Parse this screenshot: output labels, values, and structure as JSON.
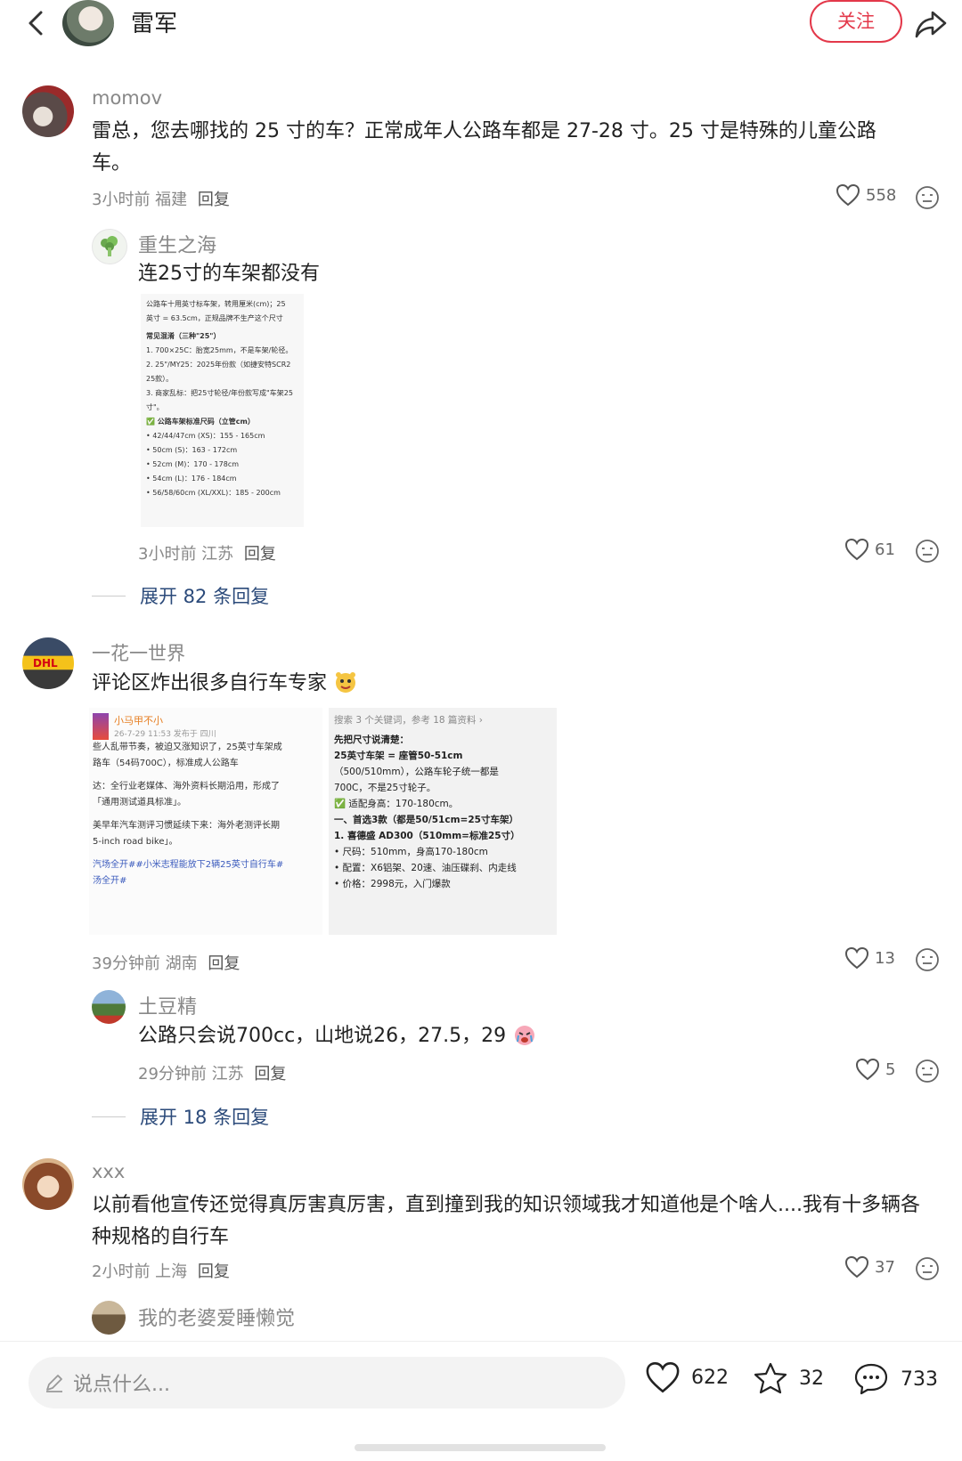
{
  "header": {
    "name": "雷军",
    "follow_label": "关注"
  },
  "comments": [
    {
      "user": "momov",
      "text": "雷总，您去哪找的 25 寸的车？正常成年人公路车都是 27-28 寸。25 寸是特殊的儿童公路车。",
      "meta": "3小时前 福建",
      "reply_label": "回复",
      "likes": "558",
      "replies": [
        {
          "user": "重生之海",
          "text": "连25寸的车架都没有",
          "meta": "3小时前 江苏",
          "reply_label": "回复",
          "likes": "61",
          "image_lines": [
            "公路车十用英寸标车架，转用厘米(cm)；25",
            "英寸 = 63.5cm，正规品牌不生产这个尺寸",
            "常见混淆（三种\"25\"）",
            "1. 700×25C：胎宽25mm，不是车架/轮径。",
            "2. 25\"/MY25：2025年份款（如捷安特SCR2 25款）。",
            "3. 商家乱标：把25寸轮径/年份款写成\"车架25寸\"。",
            "✅ 公路车架标准尺码（立管cm）",
            "• 42/44/47cm (XS)：155 - 165cm",
            "• 50cm (S)：163 - 172cm",
            "• 52cm (M)：170 - 178cm",
            "• 54cm (L)：176 - 184cm",
            "• 56/58/60cm (XL/XXL)：185 - 200cm"
          ]
        }
      ],
      "expand_label": "展开 82 条回复"
    },
    {
      "user": "一花一世界",
      "text": "评论区炸出很多自行车专家",
      "meta": "39分钟前 湖南",
      "reply_label": "回复",
      "likes": "13",
      "image_left": {
        "account": "小马甲不小",
        "date": "26-7-29 11:53  发布于 四川",
        "lines": [
          "些人乱带节奏，被迫又涨知识了，25英寸车架成",
          "路车（54码700C），标准成人公路车",
          "",
          "达：全行业老媒体、海外资料长期沿用，形成了",
          "「通用测试道具标准」。",
          "",
          "美早年汽车测评习惯延续下来：海外老测评长期",
          "5-inch road bike」。",
          "",
          "汽场全开##小米志程能放下2辆25英寸自行车#",
          "汤全开#"
        ]
      },
      "image_right": {
        "search": "搜索 3 个关键词，参考 18 篇资料 ›",
        "lines": [
          "先把尺寸说清楚：",
          "25英寸车架 = 座管50-51cm",
          "（500/510mm），公路车轮子统一都是",
          "700C，不是25寸轮子。",
          "✅ 适配身高：170-180cm。",
          "一、首选3款（都是50/51cm=25寸车架）",
          "1. 喜德盛 AD300（510mm=标准25寸）",
          "• 尺码：510mm，身高170-180cm",
          "• 配置：X6铝架、20速、油压碟刹、内走线",
          "• 价格：2998元，入门爆款"
        ]
      },
      "replies": [
        {
          "user": "土豆精",
          "text": "公路只会说700cc，山地说26，27.5，29",
          "meta": "29分钟前 江苏",
          "reply_label": "回复",
          "likes": "5"
        }
      ],
      "expand_label": "展开 18 条回复"
    },
    {
      "user": "xxx",
      "text": "以前看他宣传还觉得真厉害真厉害，直到撞到我的知识领域我才知道他是个啥人....我有十多辆各种规格的自行车",
      "meta": "2小时前 上海",
      "reply_label": "回复",
      "likes": "37",
      "replies": [
        {
          "user": "我的老婆爱睡懒觉"
        }
      ]
    }
  ],
  "bottom": {
    "input_placeholder": "说点什么...",
    "likes": "622",
    "favorites": "32",
    "comments": "733"
  },
  "icons": [
    "back-icon",
    "share-icon",
    "heart-icon",
    "face-icon",
    "pencil-icon",
    "star-icon",
    "comment-bubble-icon",
    "emoji-icon"
  ],
  "colors": {
    "accent": "#e3384a",
    "link": "#2b4a7a",
    "meta": "#888888"
  }
}
